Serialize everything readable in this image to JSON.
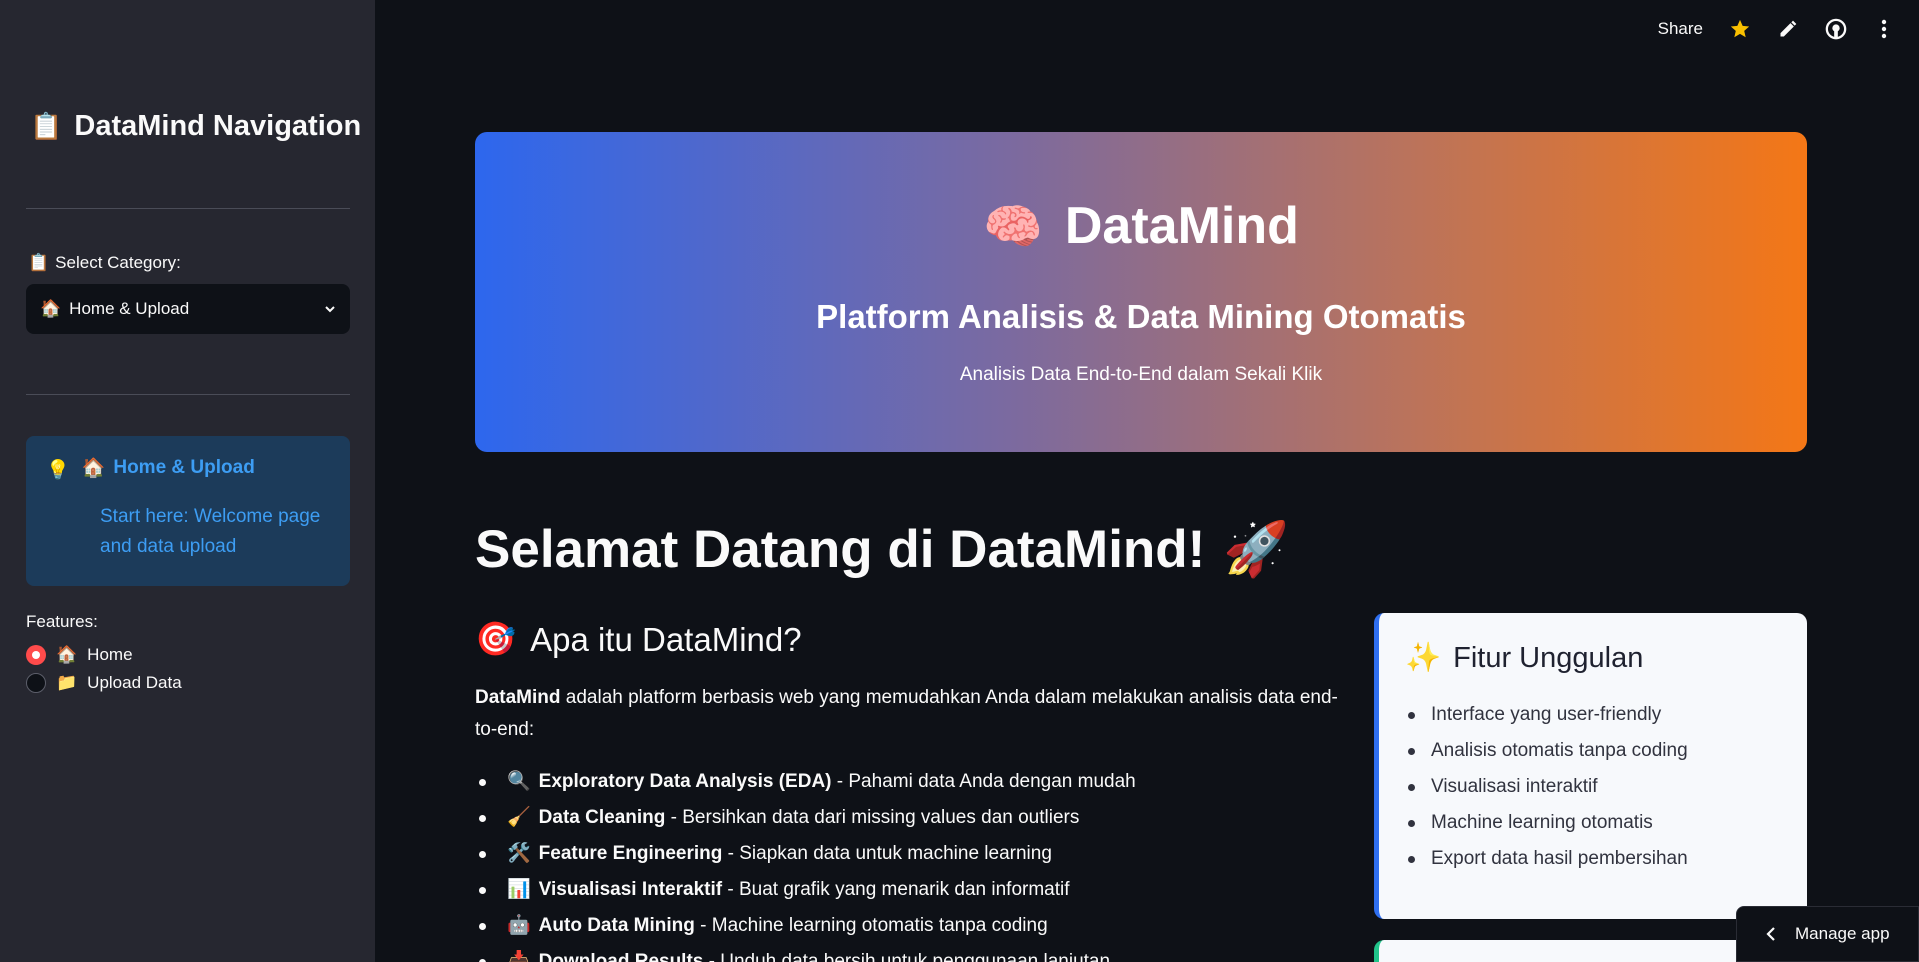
{
  "sidebar": {
    "title_emoji": "📋",
    "title": "DataMind Navigation",
    "category_emoji": "📋",
    "category_label": "Select Category:",
    "category_selected_emoji": "🏠",
    "category_selected": "Home & Upload",
    "info": {
      "bulb": "💡",
      "emoji": "🏠",
      "title": "Home & Upload",
      "description": "Start here: Welcome page and data upload"
    },
    "features_label": "Features:",
    "features": [
      {
        "emoji": "🏠",
        "label": "Home",
        "selected": true
      },
      {
        "emoji": "📁",
        "label": "Upload Data",
        "selected": false
      }
    ]
  },
  "topbar": {
    "share_label": "Share",
    "icons": [
      "star-icon",
      "edit-icon",
      "github-icon",
      "more-icon"
    ],
    "star_color": "#f9c000"
  },
  "hero": {
    "emoji": "🧠",
    "title": "DataMind",
    "subtitle": "Platform Analisis & Data Mining Otomatis",
    "tagline": "Analisis Data End-to-End dalam Sekali Klik",
    "gradient_start": "#2d67ee",
    "gradient_end": "#f47716"
  },
  "main": {
    "welcome": "Selamat Datang di DataMind!",
    "welcome_emoji": "🚀",
    "section_emoji": "🎯",
    "section_title": "Apa itu DataMind?",
    "intro_bold": "DataMind",
    "intro_rest": " adalah platform berbasis web yang memudahkan Anda dalam melakukan analisis data end-to-end:",
    "features": [
      {
        "emoji": "🔍",
        "name": "Exploratory Data Analysis (EDA)",
        "desc": " - Pahami data Anda dengan mudah"
      },
      {
        "emoji": "🧹",
        "name": "Data Cleaning",
        "desc": " - Bersihkan data dari missing values dan outliers"
      },
      {
        "emoji": "🛠️",
        "name": "Feature Engineering",
        "desc": " - Siapkan data untuk machine learning"
      },
      {
        "emoji": "📊",
        "name": "Visualisasi Interaktif",
        "desc": " - Buat grafik yang menarik dan informatif"
      },
      {
        "emoji": "🤖",
        "name": "Auto Data Mining",
        "desc": " - Machine learning otomatis tanpa coding"
      },
      {
        "emoji": "📥",
        "name": "Download Results",
        "desc": " - Unduh data bersih untuk penggunaan lanjutan"
      }
    ]
  },
  "card": {
    "emoji": "✨",
    "title": "Fitur Unggulan",
    "items": [
      "Interface yang user-friendly",
      "Analisis otomatis tanpa coding",
      "Visualisasi interaktif",
      "Machine learning otomatis",
      "Export data hasil pembersihan"
    ]
  },
  "manage_app": "Manage app"
}
